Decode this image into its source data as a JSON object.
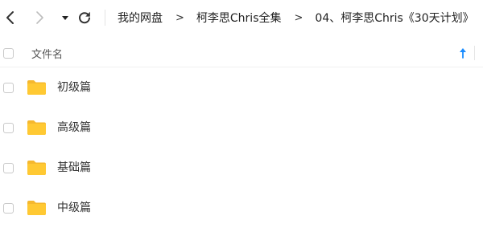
{
  "navigation": {
    "back_icon": "chevron-left-icon",
    "forward_icon": "chevron-right-icon",
    "history_icon": "caret-down-icon",
    "refresh_icon": "refresh-icon"
  },
  "breadcrumb": [
    {
      "label": "我的网盘"
    },
    {
      "label": "柯李思Chris全集"
    },
    {
      "label": "04、柯李思Chris《30天计划》"
    }
  ],
  "breadcrumb_separator": ">",
  "columns": {
    "name_header": "文件名",
    "sort_icon": "arrow-up-icon"
  },
  "files": [
    {
      "name": "初级篇",
      "type": "folder"
    },
    {
      "name": "高级篇",
      "type": "folder"
    },
    {
      "name": "基础篇",
      "type": "folder"
    },
    {
      "name": "中级篇",
      "type": "folder"
    }
  ],
  "colors": {
    "folder": "#FFC933",
    "folder_dark": "#F5B82E",
    "accent": "#1A8CFF",
    "text": "#333333"
  }
}
